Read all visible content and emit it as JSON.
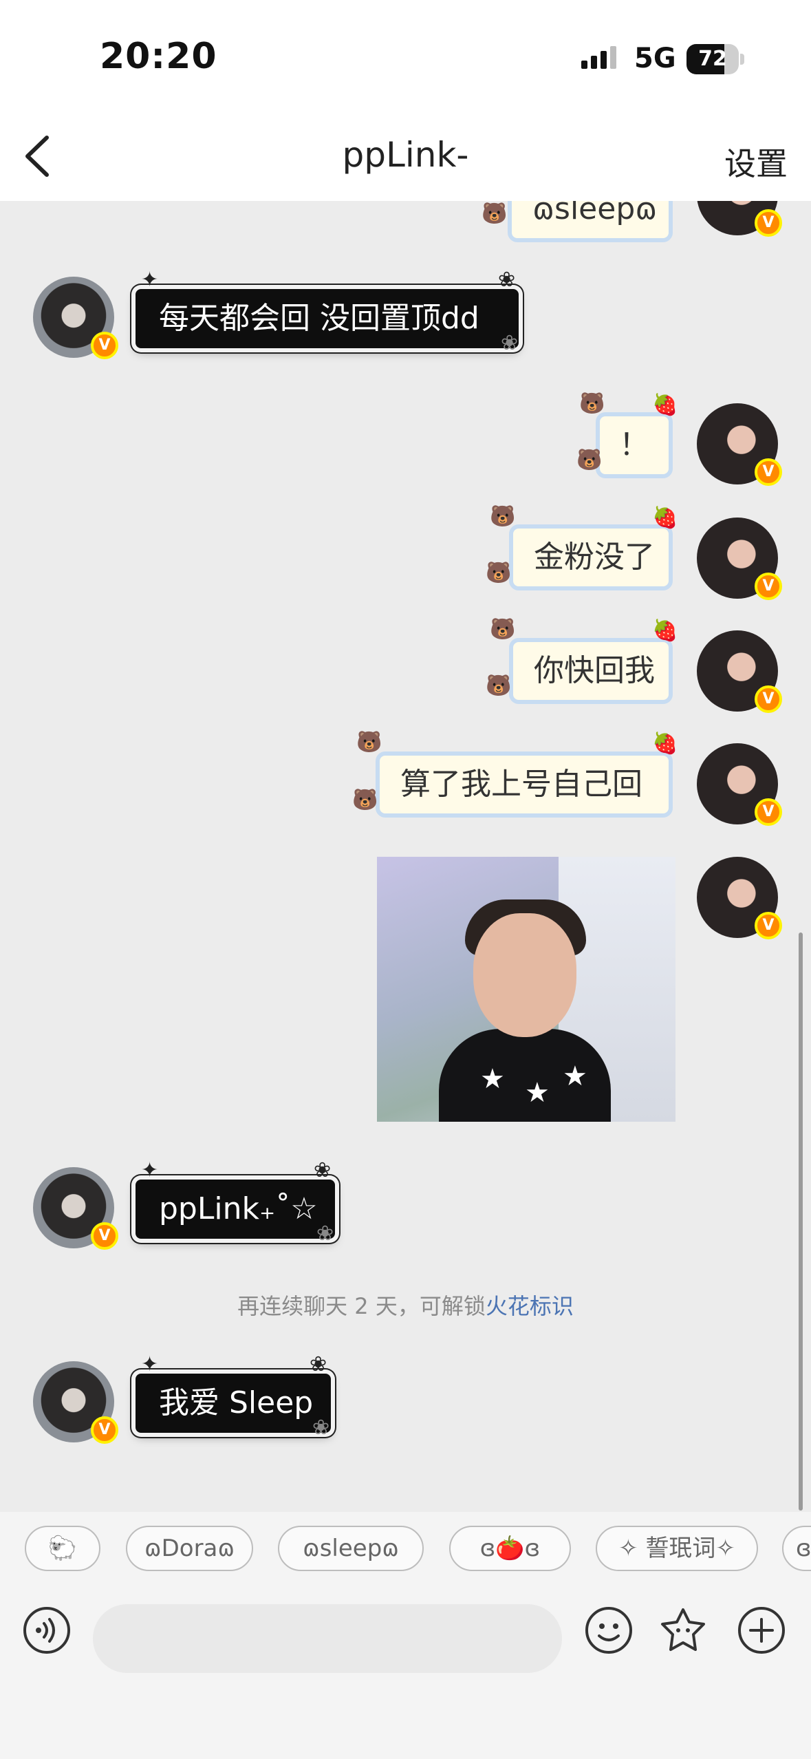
{
  "status_bar": {
    "time": "20:20",
    "network": "5G",
    "battery": "72"
  },
  "header": {
    "title": "ppLink-",
    "settings_label": "设置"
  },
  "messages": [
    {
      "from": "me",
      "style": "cute",
      "text": "ɷsleepɷ"
    },
    {
      "from": "other",
      "style": "black",
      "text": "每天都会回 没回置顶dd"
    },
    {
      "from": "me",
      "style": "cute",
      "text": "！"
    },
    {
      "from": "me",
      "style": "cute",
      "text": "金粉没了"
    },
    {
      "from": "me",
      "style": "cute",
      "text": "你快回我"
    },
    {
      "from": "me",
      "style": "cute",
      "text": "算了我上号自己回"
    },
    {
      "from": "me",
      "style": "image",
      "text": ""
    },
    {
      "from": "other",
      "style": "black",
      "text": "ppLink₊˚☆"
    },
    {
      "from": "other",
      "style": "black",
      "text": "我爱 Sleep"
    }
  ],
  "system_notice": {
    "prefix": "再连续聊天 2 天，可解锁",
    "link": "火花标识"
  },
  "quick_chips": [
    "🐑",
    "ɷDoraɷ",
    "ɷsleepɷ",
    "ɞ🍅ɞ",
    "✧ 誓珉词✧",
    "ɞ"
  ],
  "input": {
    "placeholder": ""
  },
  "icons": {
    "back": "chevron-left-icon",
    "voice": "voice-icon",
    "emoji": "emoji-icon",
    "sticker": "sticker-icon",
    "add": "plus-circle-icon"
  },
  "colors": {
    "accent_link": "#4b74b3",
    "badge": "#ff8a00"
  }
}
